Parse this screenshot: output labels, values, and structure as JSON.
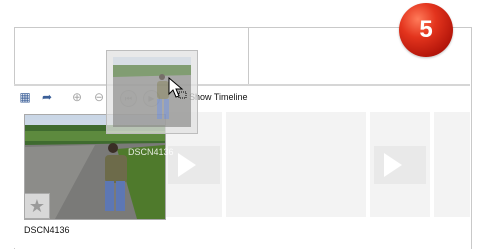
{
  "toolbar": {
    "show_timeline_label": "Show Timeline",
    "icons": [
      "storyboard-icon",
      "tools-icon",
      "zoom-in-icon",
      "zoom-out-icon",
      "rewind-icon",
      "play-icon"
    ]
  },
  "clip": {
    "name": "DSCN4136",
    "overlay_name": "DSCN4136"
  },
  "badge": {
    "number": "5",
    "color": "#d8301a"
  }
}
